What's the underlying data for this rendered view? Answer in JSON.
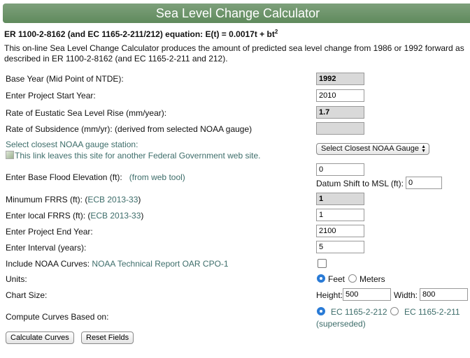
{
  "header": {
    "title": "Sea Level Change Calculator"
  },
  "equation": "ER 1100-2-8162 (and EC 1165-2-211/212) equation: E(t) = 0.0017t + bt",
  "equation_sup": "2",
  "description": "This on-line Sea Level Change Calculator produces the amount of predicted sea level change from 1986 or 1992 forward as described in ER 1100-2-8162 (and EC 1165-2-211 and 212).",
  "fields": {
    "base_year": {
      "label": "Base Year (Mid Point of NTDE):",
      "value": "1992"
    },
    "start_year": {
      "label": "Enter Project Start Year:",
      "value": "2010"
    },
    "eustatic": {
      "label": "Rate of Eustatic Sea Level Rise (mm/year):",
      "value": "1.7"
    },
    "subsidence": {
      "label": "Rate of Subsidence (mm/yr): (derived from selected NOAA gauge)",
      "value": ""
    },
    "gauge": {
      "label": "Select closest NOAA gauge station:",
      "alt_text": "This link leaves this site for another Federal Government web site.",
      "select_value": "Select Closest NOAA Gauge"
    },
    "flood": {
      "label": "Enter Base Flood Elevation (ft):",
      "link": "(from web tool)",
      "value": "0"
    },
    "datum": {
      "label": "Datum Shift to MSL (ft):",
      "value": "0"
    },
    "min_frrs": {
      "label_pre": "Minumum FRRS (ft): (",
      "link": "ECB 2013-33",
      "label_post": ")",
      "value": "1"
    },
    "local_frrs": {
      "label_pre": "Enter local FRRS (ft): (",
      "link": "ECB 2013-33",
      "label_post": ")",
      "value": "1"
    },
    "end_year": {
      "label": "Enter Project End Year:",
      "value": "2100"
    },
    "interval": {
      "label": "Enter Interval (years):",
      "value": "5"
    },
    "noaa": {
      "label": "Include NOAA Curves:",
      "link": "NOAA Technical Report OAR CPO-1",
      "checked": false
    },
    "units": {
      "label": "Units:",
      "options": [
        "Feet",
        "Meters"
      ],
      "selected": "Feet"
    },
    "chart_size": {
      "label": "Chart Size:",
      "height_label": "Height:",
      "height": "500",
      "width_label": "Width:",
      "width": "800"
    },
    "compute": {
      "label": "Compute Curves Based on:",
      "option1": "EC 1165-2-212",
      "option2": "EC 1165-2-211",
      "option2_note": "(superseded)",
      "selected": "EC 1165-2-212"
    }
  },
  "buttons": {
    "calculate": "Calculate Curves",
    "reset": "Reset Fields"
  },
  "colors": {
    "banner": "#6b936a",
    "link": "#3d6d6a",
    "radio_selected": "#2a7bd6"
  }
}
